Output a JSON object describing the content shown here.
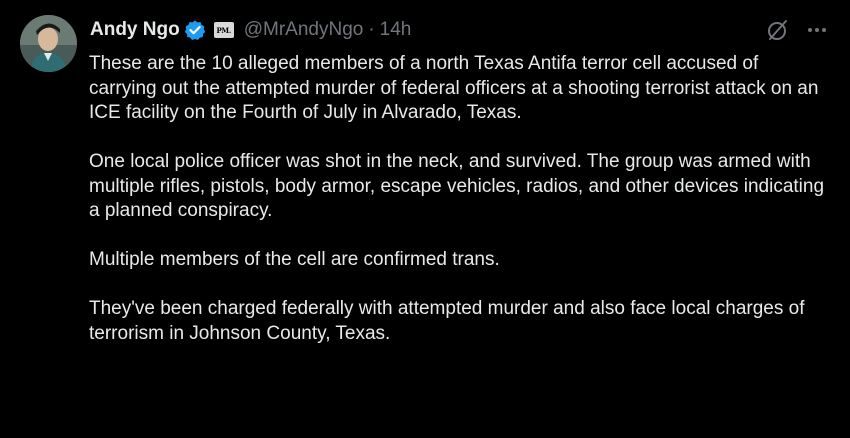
{
  "author": {
    "display_name": "Andy Ngo",
    "handle": "@MrAndyNgo",
    "separator": "·",
    "time": "14h",
    "affiliation_badge": "PM.",
    "verified": true
  },
  "icons": {
    "verified": "verified-badge-icon",
    "grok": "grok-icon",
    "more": "more-icon"
  },
  "colors": {
    "background": "#000000",
    "text": "#e7e9ea",
    "secondary": "#71767b",
    "verified_blue": "#1d9bf0"
  },
  "tweet": {
    "paragraphs": [
      "These are the 10 alleged members of a north Texas Antifa terror cell accused of carrying out the attempted murder of federal officers at a shooting terrorist attack on an ICE facility on the Fourth of July in Alvarado, Texas.",
      "One local police officer was shot in the neck, and survived. The group was armed with multiple rifles, pistols, body armor, escape vehicles, radios, and other devices indicating a planned conspiracy.",
      "Multiple members of the cell are confirmed trans.",
      "They've been charged federally with attempted murder and also face local charges of terrorism in Johnson County, Texas."
    ]
  }
}
